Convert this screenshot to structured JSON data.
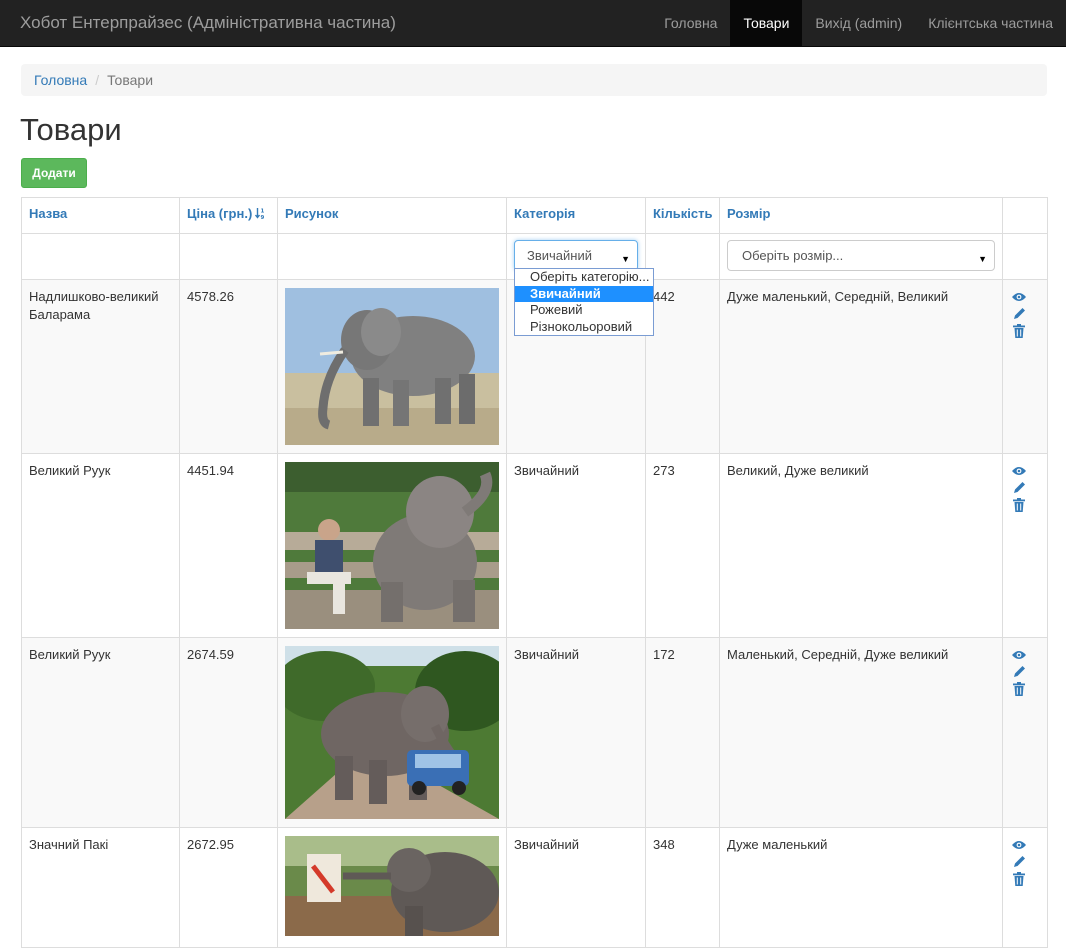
{
  "navbar": {
    "brand": "Хобот Ентерпрайзес (Адміністративна частина)",
    "items": [
      {
        "label": "Головна",
        "active": false
      },
      {
        "label": "Товари",
        "active": true
      },
      {
        "label": "Вихід (admin)",
        "active": false
      },
      {
        "label": "Клієнтська частина",
        "active": false
      }
    ]
  },
  "breadcrumb": {
    "home": "Головна",
    "separator": "/",
    "current": "Товари"
  },
  "page_title": "Товари",
  "add_button": "Додати",
  "columns": {
    "name": "Назва",
    "price": "Ціна (грн.)",
    "image": "Рисунок",
    "category": "Категорія",
    "quantity": "Кількість",
    "size": "Розмір"
  },
  "filters": {
    "category_selected": "Звичайний",
    "size_placeholder": "Оберіть розмір..."
  },
  "category_dropdown": {
    "options": [
      "Оберіть категорію...",
      "Звичайний",
      "Рожевий",
      "Різнокольоровий"
    ],
    "selected_index": 1
  },
  "rows": [
    {
      "name": "Надлишково-великий Баларама",
      "price": "4578.26",
      "image": "elephant-walking",
      "category": "",
      "quantity": "442",
      "sizes": "Дуже маленький, Середній, Великий"
    },
    {
      "name": "Великий Руук",
      "price": "4451.94",
      "image": "elephant-sitting-with-man",
      "category": "Звичайний",
      "quantity": "273",
      "sizes": "Великий, Дуже великий"
    },
    {
      "name": "Великий Руук",
      "price": "2674.59",
      "image": "elephant-on-car",
      "category": "Звичайний",
      "quantity": "172",
      "sizes": "Маленький, Середній, Дуже великий"
    },
    {
      "name": "Значний Пакі",
      "price": "2672.95",
      "image": "elephant-painting",
      "category": "Звичайний",
      "quantity": "348",
      "sizes": "Дуже маленький"
    }
  ],
  "colors": {
    "navbar": "#222222",
    "link": "#337ab7",
    "success": "#5cb85c",
    "select_highlight": "#1e90ff"
  }
}
